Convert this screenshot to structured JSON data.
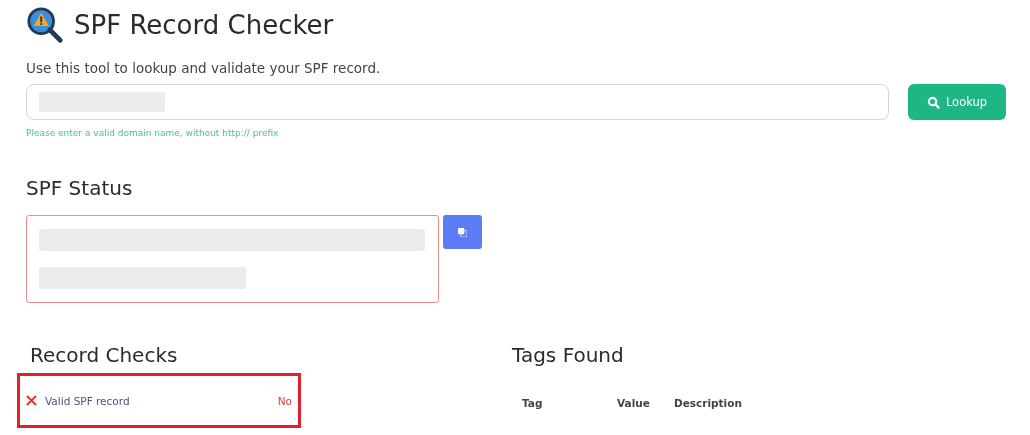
{
  "header": {
    "title": "SPF Record Checker",
    "description": "Use this tool to lookup and validate your SPF record."
  },
  "lookup": {
    "button": "Lookup",
    "hint": "Please enter a valid domain name, without http:// prefix"
  },
  "status": {
    "heading": "SPF Status",
    "valid": false
  },
  "record_checks": {
    "heading": "Record Checks",
    "highlighted": true,
    "items": [
      {
        "label": "Valid SPF record",
        "passed": false,
        "result": "No"
      }
    ]
  },
  "tags_found": {
    "heading": "Tags Found",
    "columns": [
      "Tag",
      "Value",
      "Description"
    ]
  }
}
